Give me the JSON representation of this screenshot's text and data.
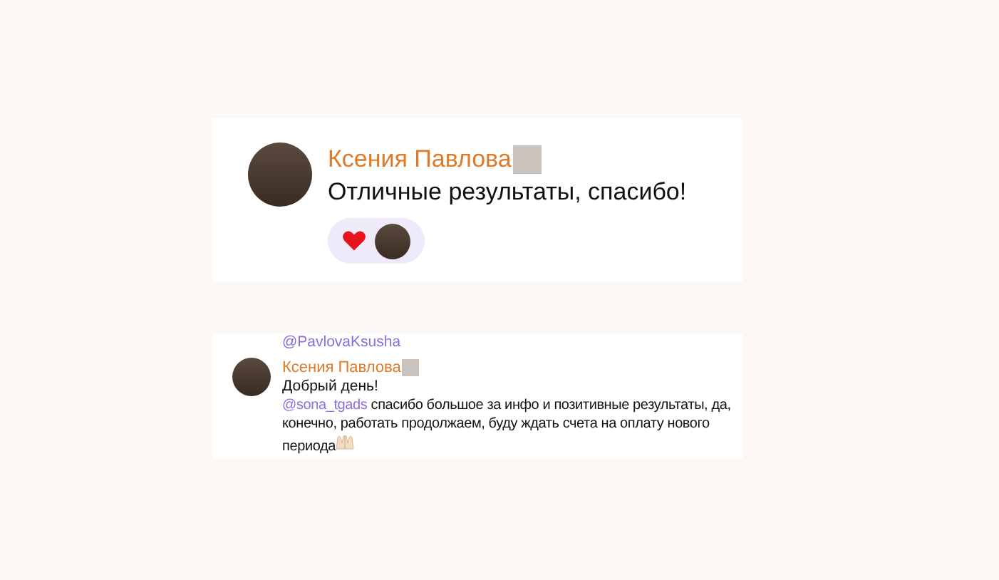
{
  "messages": [
    {
      "author": "Ксения Павлова",
      "lines": [
        "Отличные результаты, спасибо!"
      ],
      "reactions": [
        {
          "kind": "heart"
        }
      ],
      "kind": "reaction"
    },
    {
      "quoted": "@PavlovaKsusha",
      "author": "Ксения Павлова",
      "lines": [
        "Добрый день!"
      ],
      "mention": "@sona_tgads",
      "body": "спасибо большое за инфо и позитивные результаты, да, конечно, работать продолжаем, буду ждать счета на оплату нового периода",
      "kind": "reply"
    }
  ]
}
